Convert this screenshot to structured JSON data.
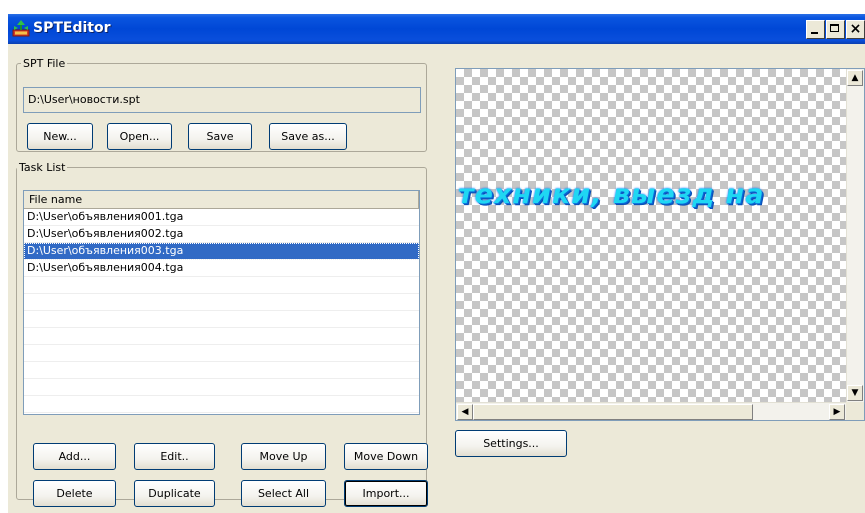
{
  "window": {
    "title": "SPTEditor"
  },
  "spt_file": {
    "group_label": "SPT File",
    "path": "D:\\User\\новости.spt",
    "buttons": {
      "new": "New...",
      "open": "Open...",
      "save": "Save",
      "save_as": "Save as..."
    }
  },
  "task_list": {
    "group_label": "Task List",
    "column_header": "File name",
    "rows": [
      "D:\\User\\объявления001.tga",
      "D:\\User\\объявления002.tga",
      "D:\\User\\объявления003.tga",
      "D:\\User\\объявления004.tga"
    ],
    "selected_row": "D:\\User\\объявления003.tga",
    "buttons": {
      "add": "Add...",
      "edit": "Edit..",
      "move_up": "Move Up",
      "move_down": "Move Down",
      "delete": "Delete",
      "duplicate": "Duplicate",
      "select_all": "Select All",
      "import": "Import..."
    }
  },
  "preview": {
    "text": "техники, выезд на",
    "text_color": "#1fd7f3",
    "background": "transparency checkerboard"
  },
  "settings_button": "Settings...",
  "colors": {
    "titlebar": "#0047d6",
    "selection": "#316ac5",
    "window_face": "#ece9d8"
  }
}
